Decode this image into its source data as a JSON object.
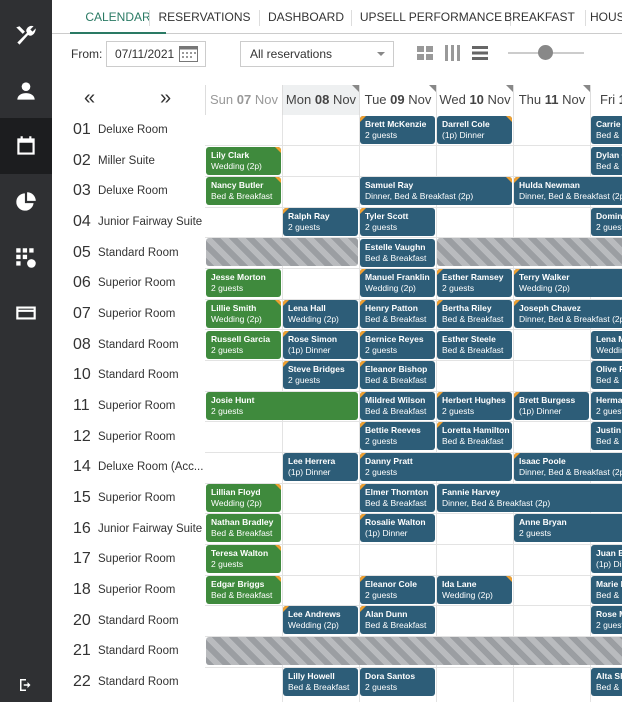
{
  "tabs": [
    "CALENDAR",
    "RESERVATIONS",
    "DASHBOARD",
    "UPSELL PERFORMANCE",
    "BREAKFAST",
    "HOUS"
  ],
  "filters": {
    "from_label": "From:",
    "from_date": "07/11/2021",
    "reservation_select": "All reservations"
  },
  "navigation": {
    "prev_label": "«",
    "next_label": "»"
  },
  "days": [
    {
      "dow": "Sun",
      "num": "07",
      "mon": "Nov"
    },
    {
      "dow": "Mon",
      "num": "08",
      "mon": "Nov"
    },
    {
      "dow": "Tue",
      "num": "09",
      "mon": "Nov"
    },
    {
      "dow": "Wed",
      "num": "10",
      "mon": "Nov"
    },
    {
      "dow": "Thu",
      "num": "11",
      "mon": "Nov"
    },
    {
      "dow": "Fri",
      "num": "1",
      "mon": ""
    }
  ],
  "rooms": [
    {
      "num": "01",
      "type": "Deluxe Room"
    },
    {
      "num": "02",
      "type": "Miller Suite"
    },
    {
      "num": "03",
      "type": "Deluxe Room"
    },
    {
      "num": "04",
      "type": "Junior Fairway Suite"
    },
    {
      "num": "05",
      "type": "Standard Room"
    },
    {
      "num": "06",
      "type": "Superior Room"
    },
    {
      "num": "07",
      "type": "Superior Room"
    },
    {
      "num": "08",
      "type": "Standard Room"
    },
    {
      "num": "10",
      "type": "Standard Room"
    },
    {
      "num": "11",
      "type": "Superior Room"
    },
    {
      "num": "12",
      "type": "Superior Room"
    },
    {
      "num": "14",
      "type": "Deluxe Room (Acc..."
    },
    {
      "num": "15",
      "type": "Superior Room"
    },
    {
      "num": "16",
      "type": "Junior Fairway Suite"
    },
    {
      "num": "17",
      "type": "Superior Room"
    },
    {
      "num": "18",
      "type": "Superior Room"
    },
    {
      "num": "20",
      "type": "Standard Room"
    },
    {
      "num": "21",
      "type": "Standard Room"
    },
    {
      "num": "22",
      "type": "Standard Room"
    }
  ],
  "bookings": [
    {
      "name": "Brett McKenzie",
      "detail": "2 guests",
      "color": "blue"
    },
    {
      "name": "Darrell Cole",
      "detail": "(1p) Dinner",
      "color": "blue"
    },
    {
      "name": "Carrie C",
      "detail": "Bed & B",
      "color": "blue"
    },
    {
      "name": "Lily Clark",
      "detail": "Wedding (2p)",
      "color": "green"
    },
    {
      "name": "Dylan C",
      "detail": "Bed & B",
      "color": "blue"
    },
    {
      "name": "Nancy Butler",
      "detail": "Bed & Breakfast",
      "color": "green"
    },
    {
      "name": "Samuel Ray",
      "detail": "Dinner, Bed & Breakfast (2p)",
      "color": "blue"
    },
    {
      "name": "Hulda Newman",
      "detail": "Dinner, Bed & Breakfast (2p)",
      "color": "blue"
    },
    {
      "name": "Ralph Ray",
      "detail": "2 guests",
      "color": "blue"
    },
    {
      "name": "Tyler Scott",
      "detail": "2 guests",
      "color": "blue"
    },
    {
      "name": "Domini",
      "detail": "2 guest",
      "color": "blue"
    },
    {
      "name": "Estelle Vaughn",
      "detail": "Bed & Breakfast",
      "color": "blue"
    },
    {
      "name": "Jesse Morton",
      "detail": "2 guests",
      "color": "green"
    },
    {
      "name": "Manuel Franklin",
      "detail": "Wedding (2p)",
      "color": "blue"
    },
    {
      "name": "Esther Ramsey",
      "detail": "2 guests",
      "color": "blue"
    },
    {
      "name": "Terry Walker",
      "detail": "Wedding (2p)",
      "color": "blue"
    },
    {
      "name": "Lillie Smith",
      "detail": "Wedding (2p)",
      "color": "green"
    },
    {
      "name": "Lena Hall",
      "detail": "Wedding (2p)",
      "color": "blue"
    },
    {
      "name": "Henry Patton",
      "detail": "Bed & Breakfast",
      "color": "blue"
    },
    {
      "name": "Bertha Riley",
      "detail": "Bed & Breakfast",
      "color": "blue"
    },
    {
      "name": "Joseph Chavez",
      "detail": "Dinner, Bed & Breakfast (2p)",
      "color": "blue"
    },
    {
      "name": "Russell Garcia",
      "detail": "2 guests",
      "color": "green"
    },
    {
      "name": "Rose Simon",
      "detail": "(1p) Dinner",
      "color": "blue"
    },
    {
      "name": "Bernice Reyes",
      "detail": "2 guests",
      "color": "blue"
    },
    {
      "name": "Esther Steele",
      "detail": "Bed & Breakfast",
      "color": "blue"
    },
    {
      "name": "Lena M",
      "detail": "Weddin",
      "color": "blue"
    },
    {
      "name": "Steve Bridges",
      "detail": "2 guests",
      "color": "blue"
    },
    {
      "name": "Eleanor Bishop",
      "detail": "Bed & Breakfast",
      "color": "blue"
    },
    {
      "name": "Olive F",
      "detail": "Bed & B",
      "color": "blue"
    },
    {
      "name": "Josie Hunt",
      "detail": "2 guests",
      "color": "green"
    },
    {
      "name": "Mildred Wilson",
      "detail": "Bed & Breakfast",
      "color": "blue"
    },
    {
      "name": "Herbert Hughes",
      "detail": "2 guests",
      "color": "blue"
    },
    {
      "name": "Brett Burgess",
      "detail": "(1p) Dinner",
      "color": "blue"
    },
    {
      "name": "Herma",
      "detail": "2 guest",
      "color": "blue"
    },
    {
      "name": "Bettie Reeves",
      "detail": "2 guests",
      "color": "blue"
    },
    {
      "name": "Loretta Hamilton",
      "detail": "Bed & Breakfast",
      "color": "blue"
    },
    {
      "name": "Justin",
      "detail": "Bed & B",
      "color": "blue"
    },
    {
      "name": "Lee Herrera",
      "detail": "(1p) Dinner",
      "color": "blue"
    },
    {
      "name": "Danny Pratt",
      "detail": "2 guests",
      "color": "blue"
    },
    {
      "name": "Isaac Poole",
      "detail": "Dinner, Bed & Breakfast (2p)",
      "color": "blue"
    },
    {
      "name": "Lillian Floyd",
      "detail": "Wedding (2p)",
      "color": "green"
    },
    {
      "name": "Elmer Thornton",
      "detail": "Bed & Breakfast",
      "color": "blue"
    },
    {
      "name": "Fannie Harvey",
      "detail": "Dinner, Bed & Breakfast (2p)",
      "color": "blue"
    },
    {
      "name": "Nathan Bradley",
      "detail": "Bed & Breakfast",
      "color": "green"
    },
    {
      "name": "Rosalie Walton",
      "detail": "(1p) Dinner",
      "color": "blue"
    },
    {
      "name": "Anne Bryan",
      "detail": "2 guests",
      "color": "blue"
    },
    {
      "name": "Teresa Walton",
      "detail": "2 guests",
      "color": "green"
    },
    {
      "name": "Juan B",
      "detail": "(1p) Din",
      "color": "blue"
    },
    {
      "name": "Edgar Briggs",
      "detail": "Bed & Breakfast",
      "color": "green"
    },
    {
      "name": "Eleanor Cole",
      "detail": "2 guests",
      "color": "blue"
    },
    {
      "name": "Ida Lane",
      "detail": "Wedding (2p)",
      "color": "blue"
    },
    {
      "name": "Marie E",
      "detail": "Bed & B",
      "color": "blue"
    },
    {
      "name": "Lee Andrews",
      "detail": "Wedding (2p)",
      "color": "blue"
    },
    {
      "name": "Alan Dunn",
      "detail": "Bed & Breakfast",
      "color": "blue"
    },
    {
      "name": "Rose M",
      "detail": "2 guest",
      "color": "blue"
    },
    {
      "name": "Lilly Howell",
      "detail": "Bed & Breakfast",
      "color": "blue"
    },
    {
      "name": "Dora Santos",
      "detail": "2 guests",
      "color": "blue"
    },
    {
      "name": "Alta Sh",
      "detail": "Bed & B",
      "color": "blue"
    }
  ],
  "colors": {
    "accent": "#2a7a64",
    "booking_blue": "#2d5d78",
    "booking_green": "#3f8a3d",
    "flag": "#f0a030",
    "sidebar": "#2f3033"
  },
  "icons": [
    "tools-icon",
    "user-icon",
    "calendar-icon",
    "pie-chart-icon",
    "grid-clock-icon",
    "card-icon",
    "logout-icon"
  ]
}
